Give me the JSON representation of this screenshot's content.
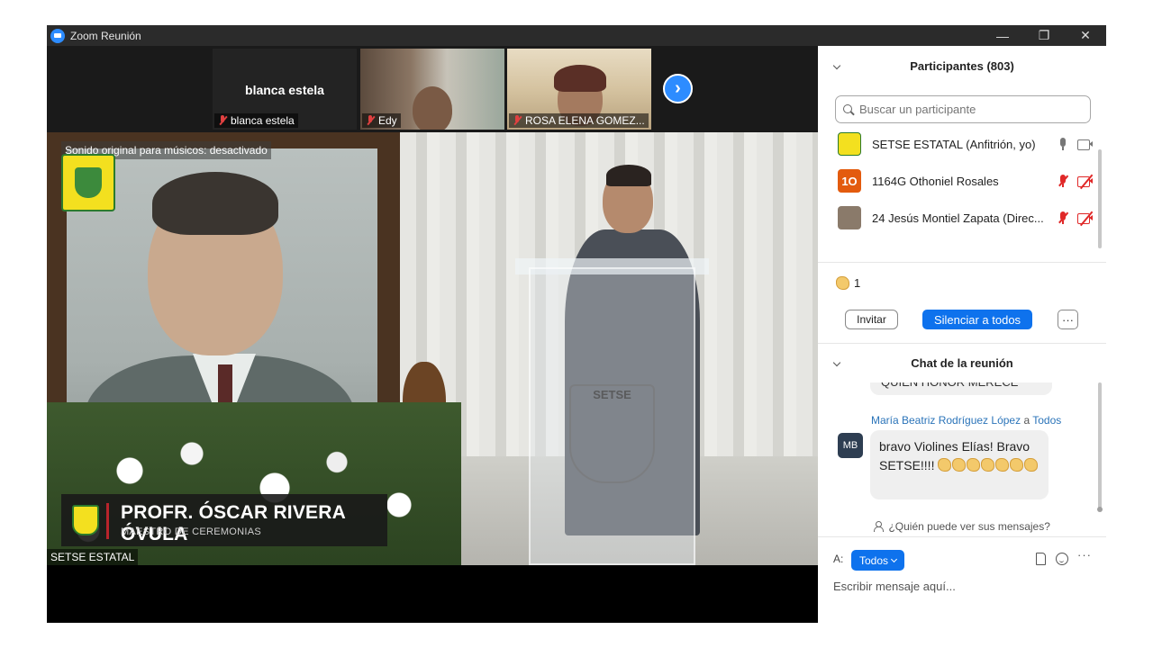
{
  "window": {
    "title": "Zoom Reunión",
    "controls": [
      "—",
      "❐",
      "✕"
    ]
  },
  "gallery_strip": {
    "tiles": [
      {
        "big_name": "blanca estela",
        "label": "blanca estela",
        "audio": "muted"
      },
      {
        "label": "Edy",
        "audio": "muted"
      },
      {
        "label": "ROSA ELENA GOMEZ...",
        "audio": "muted"
      }
    ],
    "next_icon": "chevron-right-icon"
  },
  "main_video": {
    "sound_status": "Sonido original para músicos: desactivado",
    "lower_third_name": "PROFR. ÓSCAR RIVERA ÓVULA",
    "lower_third_role": "MAESTRO DE CEREMONIAS",
    "speaker_label": "SETSE ESTATAL",
    "podium_text": "SETSE"
  },
  "participants": {
    "header": "Participantes (803)",
    "search_placeholder": "Buscar un participante",
    "rows": [
      {
        "name": "SETSE ESTATAL (Anfitrión, yo)",
        "avatar_text": "",
        "avatar_color": "#f3e01f",
        "mic": "on",
        "video": "on"
      },
      {
        "name": "1164G Othoniel Rosales",
        "avatar_text": "1O",
        "avatar_color": "#e35b0e",
        "mic": "muted",
        "video": "off"
      },
      {
        "name": "24 Jesús Montiel Zapata (Direc...",
        "avatar_text": "",
        "avatar_color": "#8a7a6a",
        "mic": "muted",
        "video": "off"
      }
    ],
    "reaction_count": "1",
    "reaction_icon": "clapping-hands-icon",
    "invite_label": "Invitar",
    "mute_all_label": "Silenciar a todos",
    "more_label": "···"
  },
  "chat": {
    "header": "Chat de la reunión",
    "prev_message_fragment": "QUIEN HONOR MERECE",
    "sender": "María Beatriz Rodríguez López",
    "to_word": "a",
    "recipient": "Todos",
    "sender_initials": "MB",
    "message": "bravo Violines Elías! Bravo SETSE!!!!",
    "claps": 7,
    "who_sees": "¿Quién puede ver sus mensajes?",
    "to_label": "A:",
    "to_value": "Todos",
    "input_placeholder": "Escribir mensaje aquí...",
    "more_label": "···"
  },
  "colors": {
    "accent": "#0e72ed",
    "title_bar": "#2b2b2b",
    "muted_red": "#e02828"
  }
}
